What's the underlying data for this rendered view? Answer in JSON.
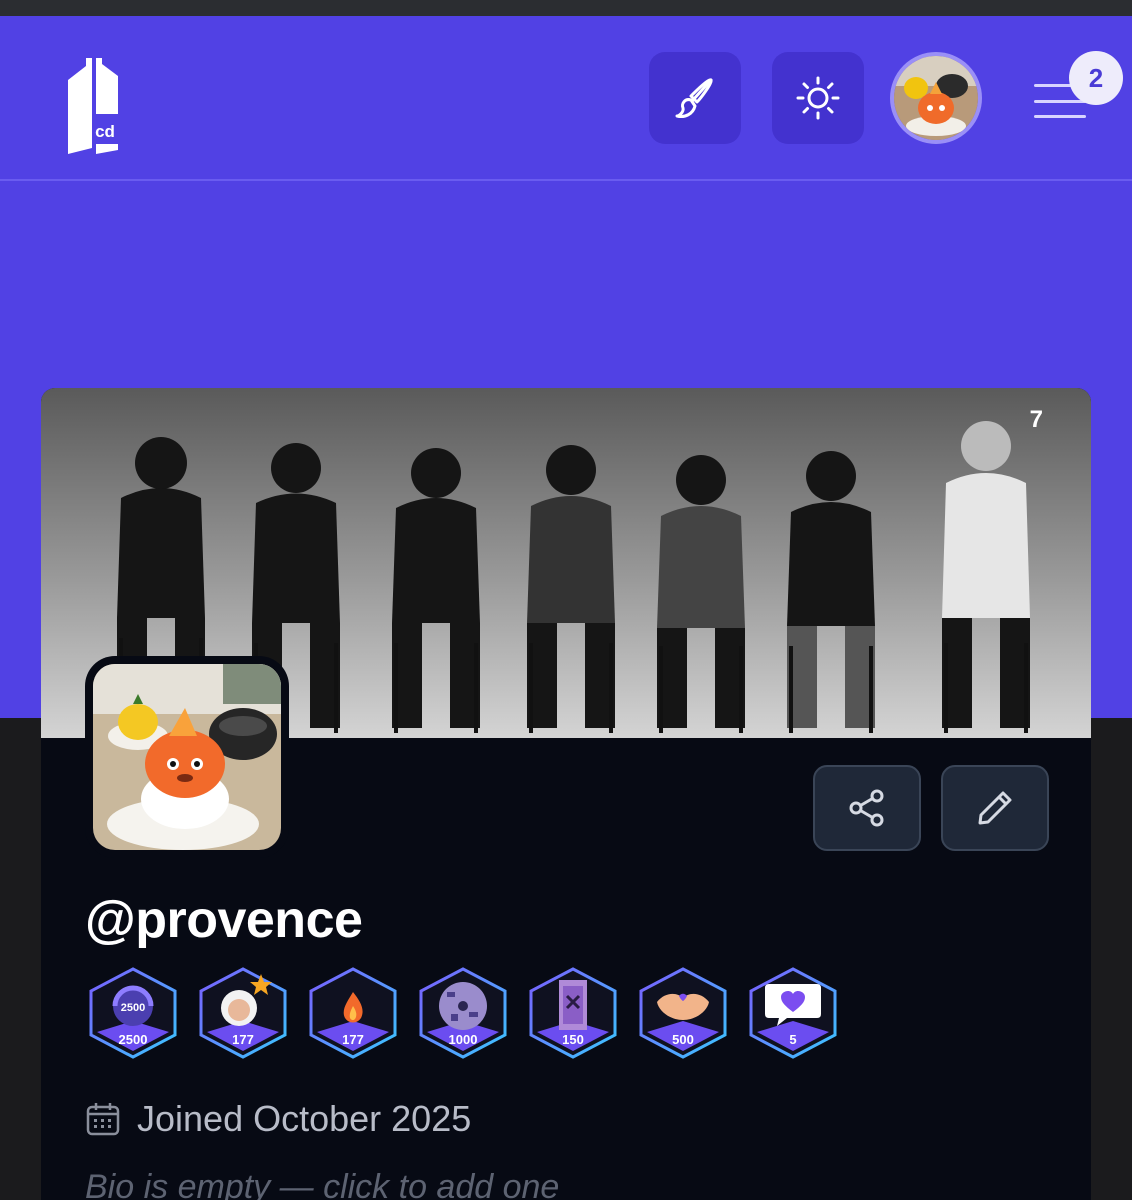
{
  "header": {
    "logo_text": "cd",
    "notifications_count": "2",
    "icons": {
      "theme": "paintbrush-icon",
      "light_mode": "sun-icon",
      "menu": "hamburger-menu-icon"
    }
  },
  "profile": {
    "banner_count": "7",
    "username": "@provence",
    "joined": "Joined October 2025",
    "bio_placeholder": "Bio is empty — click to add one",
    "actions": {
      "share": "share-icon",
      "edit": "pencil-icon"
    },
    "badges": [
      {
        "value": "2500",
        "icon": "headphones-figure"
      },
      {
        "value": "177",
        "icon": "astronaut-star"
      },
      {
        "value": "177",
        "icon": "flame"
      },
      {
        "value": "1000",
        "icon": "vinyl-disc"
      },
      {
        "value": "150",
        "icon": "purple-poster"
      },
      {
        "value": "500",
        "icon": "handshake"
      },
      {
        "value": "5",
        "icon": "heart-speech-bubble"
      }
    ]
  },
  "colors": {
    "brand": "#5141e4",
    "card_bg": "#070a14",
    "badge_purple": "#6b4df0"
  }
}
